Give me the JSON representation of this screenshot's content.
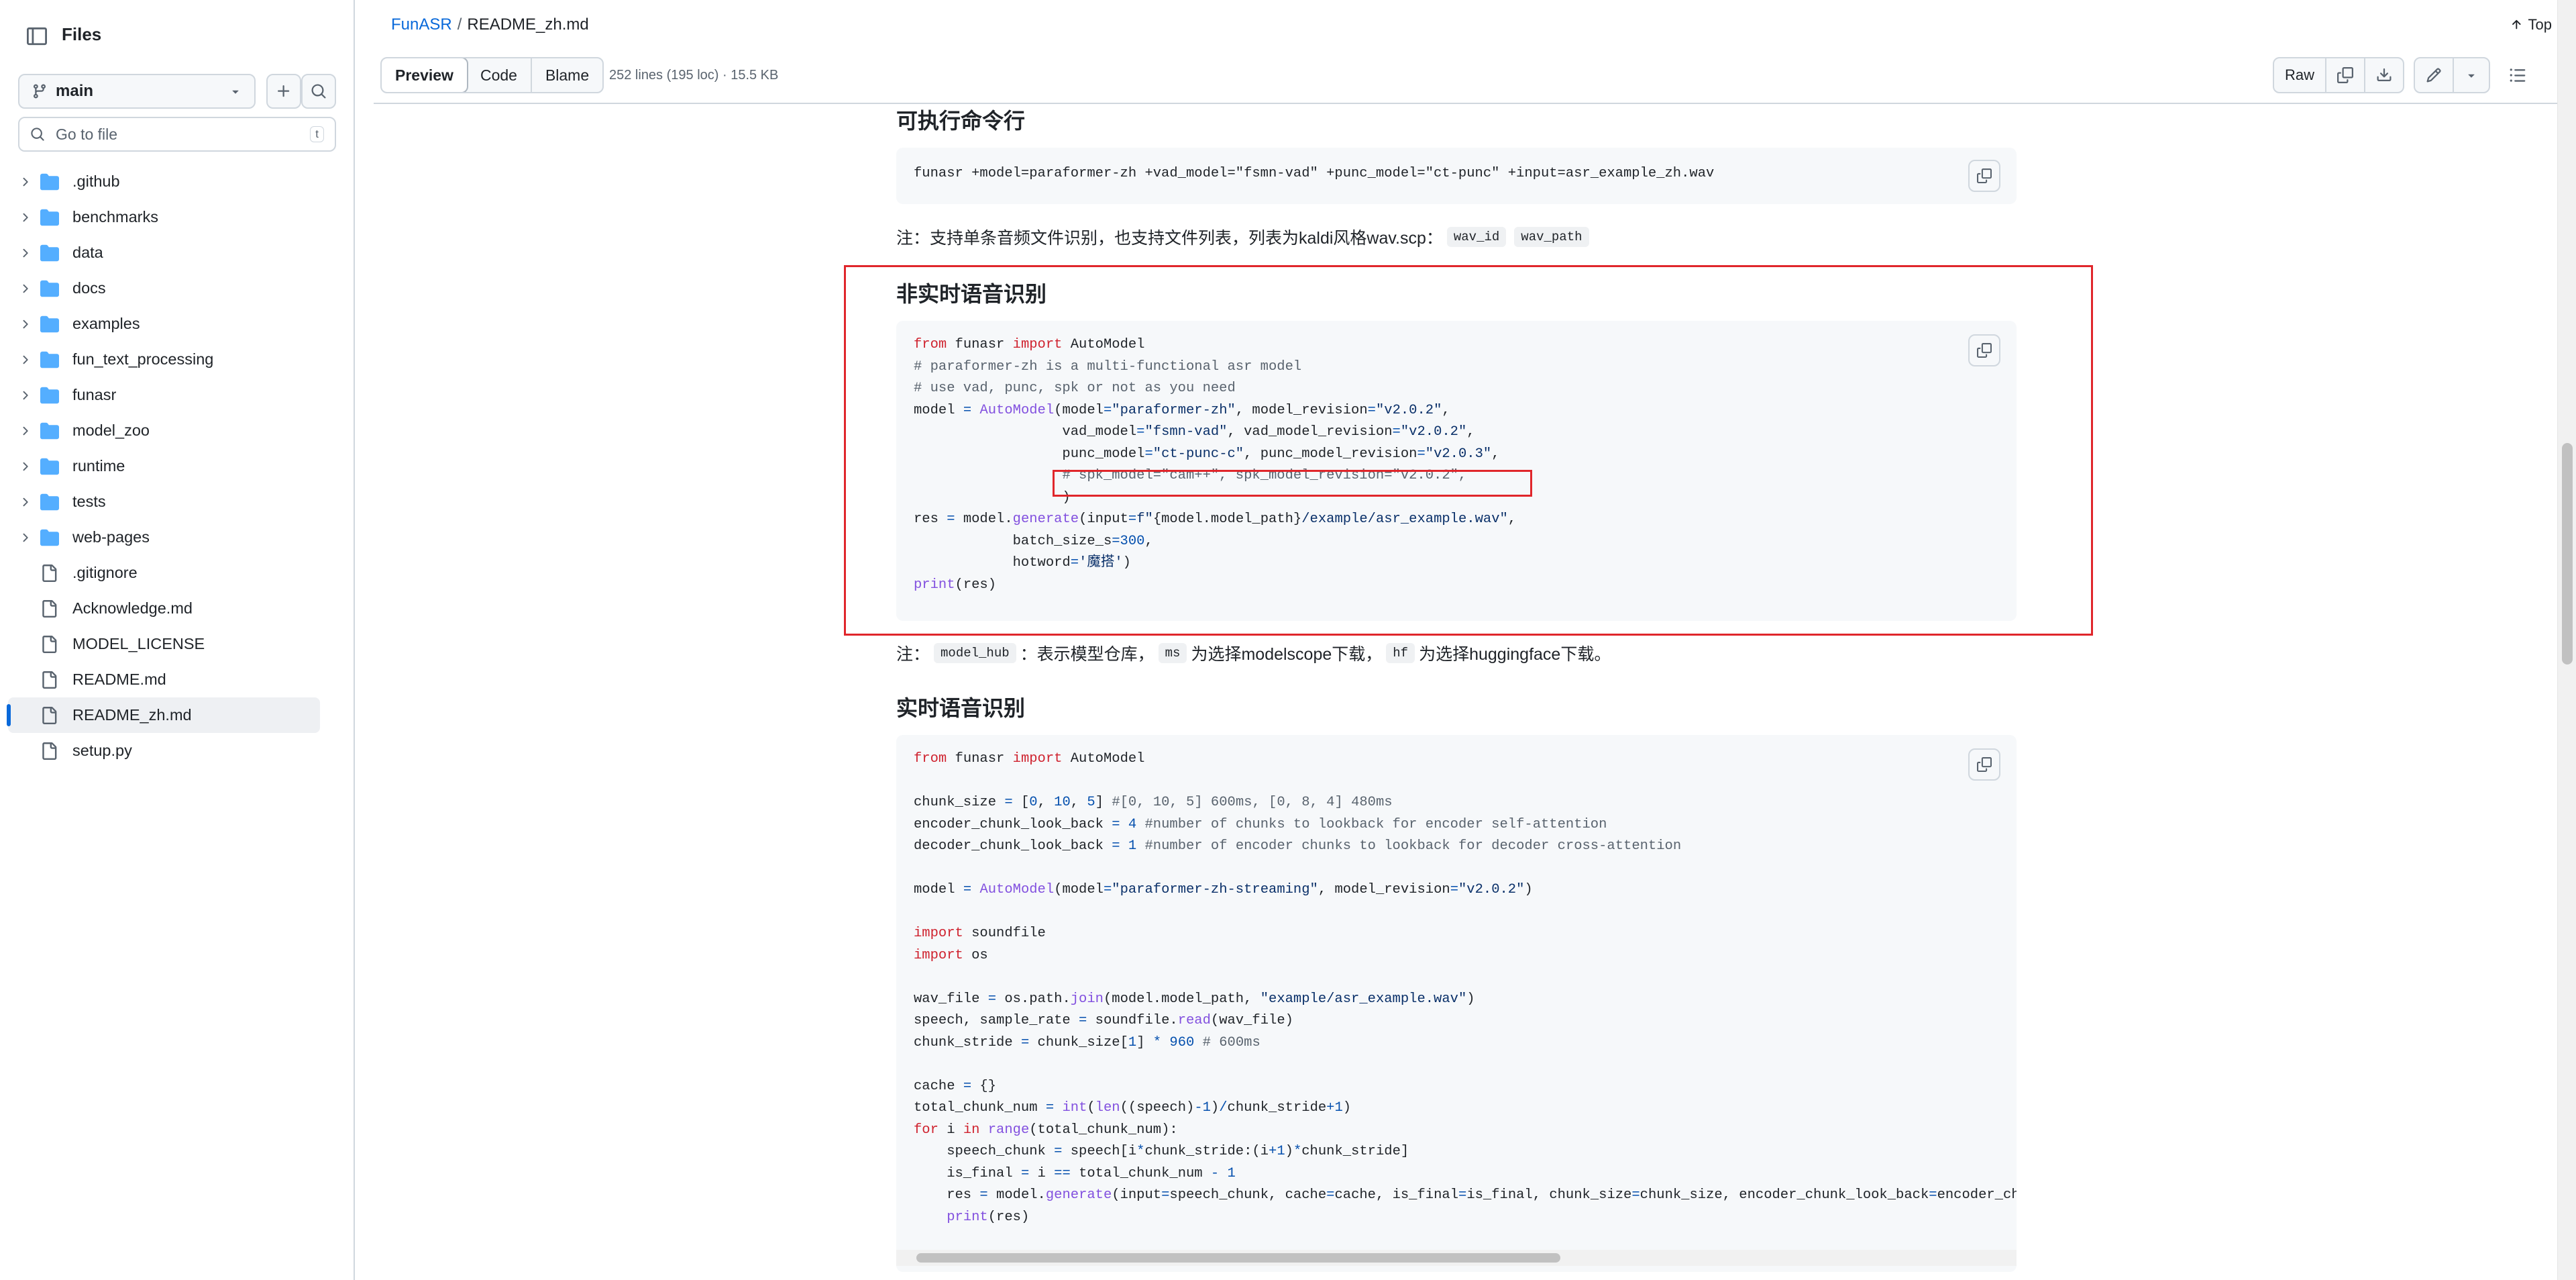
{
  "sidebar": {
    "title": "Files",
    "branch": "main",
    "search_placeholder": "Go to file",
    "search_shortcut": "t",
    "items": [
      {
        "type": "folder",
        "name": ".github"
      },
      {
        "type": "folder",
        "name": "benchmarks"
      },
      {
        "type": "folder",
        "name": "data"
      },
      {
        "type": "folder",
        "name": "docs"
      },
      {
        "type": "folder",
        "name": "examples"
      },
      {
        "type": "folder",
        "name": "fun_text_processing"
      },
      {
        "type": "folder",
        "name": "funasr"
      },
      {
        "type": "folder",
        "name": "model_zoo"
      },
      {
        "type": "folder",
        "name": "runtime"
      },
      {
        "type": "folder",
        "name": "tests"
      },
      {
        "type": "folder",
        "name": "web-pages"
      },
      {
        "type": "file",
        "name": ".gitignore"
      },
      {
        "type": "file",
        "name": "Acknowledge.md"
      },
      {
        "type": "file",
        "name": "MODEL_LICENSE"
      },
      {
        "type": "file",
        "name": "README.md"
      },
      {
        "type": "file",
        "name": "README_zh.md",
        "active": true
      },
      {
        "type": "file",
        "name": "setup.py"
      }
    ]
  },
  "header": {
    "breadcrumb_repo": "FunASR",
    "breadcrumb_sep": "/",
    "breadcrumb_file": "README_zh.md",
    "top_label": "Top",
    "tabs": [
      "Preview",
      "Code",
      "Blame"
    ],
    "file_info": "252 lines (195 loc) · 15.5 KB",
    "raw_label": "Raw"
  },
  "content": {
    "h_cli": "可执行命令行",
    "cli_code": "funasr +model=paraformer-zh +vad_model=\"fsmn-vad\" +punc_model=\"ct-punc\" +input=asr_example_zh.wav",
    "note1_text": "注：支持单条音频文件识别，也支持文件列表，列表为kaldi风格wav.scp：",
    "note1_code1": "wav_id",
    "note1_code2": "wav_path",
    "h_offline": "非实时语音识别",
    "note2_prefix": "注：",
    "note2_code1": "model_hub",
    "note2_text1": "：表示模型仓库，",
    "note2_code2": "ms",
    "note2_text2": "为选择modelscope下载，",
    "note2_code3": "hf",
    "note2_text3": "为选择huggingface下载。",
    "h_stream": "实时语音识别"
  },
  "colors": {
    "highlight_box": "#e0262b",
    "link": "#0969da"
  }
}
